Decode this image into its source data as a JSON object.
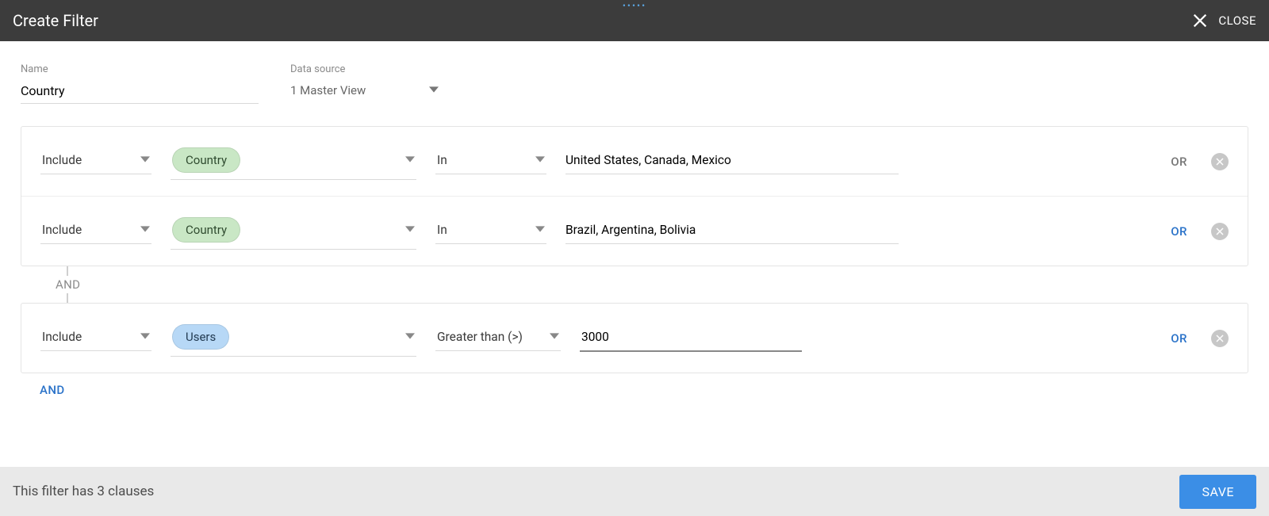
{
  "header": {
    "title": "Create Filter",
    "close": "CLOSE"
  },
  "fields": {
    "name_label": "Name",
    "name_value": "Country",
    "ds_label": "Data source",
    "ds_value": "1 Master View"
  },
  "groups": [
    {
      "clauses": [
        {
          "include": "Include",
          "dim": "Country",
          "dim_kind": "green",
          "op": "In",
          "value_type": "text",
          "value": "United States, Canada, Mexico",
          "or_muted": true
        },
        {
          "include": "Include",
          "dim": "Country",
          "dim_kind": "green",
          "op": "In",
          "value_type": "text",
          "value": "Brazil, Argentina, Bolivia",
          "or_muted": false
        }
      ]
    },
    {
      "clauses": [
        {
          "include": "Include",
          "dim": "Users",
          "dim_kind": "blue",
          "op": "Greater than (>)",
          "value_type": "number",
          "value": "3000",
          "or_muted": false
        }
      ]
    }
  ],
  "connector_label": "AND",
  "and_add_label": "AND",
  "or_label": "OR",
  "footer": {
    "msg": "This filter has 3 clauses",
    "save": "SAVE"
  }
}
